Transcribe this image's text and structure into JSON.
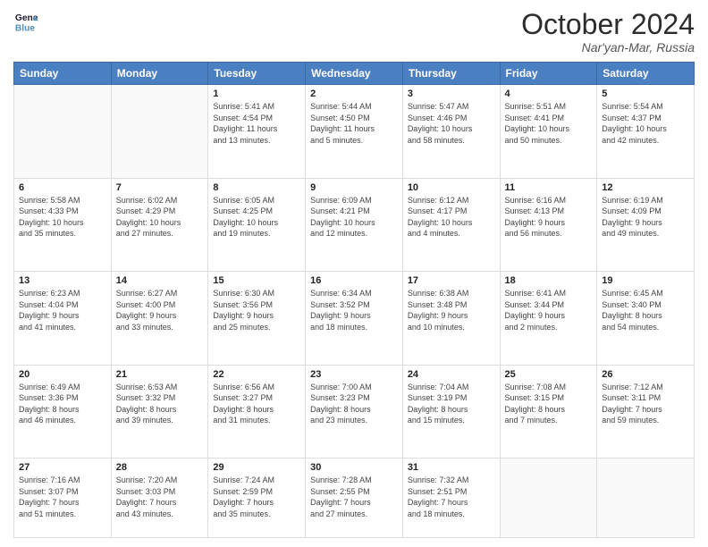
{
  "header": {
    "logo_line1": "General",
    "logo_line2": "Blue",
    "month": "October 2024",
    "location": "Nar'yan-Mar, Russia"
  },
  "weekdays": [
    "Sunday",
    "Monday",
    "Tuesday",
    "Wednesday",
    "Thursday",
    "Friday",
    "Saturday"
  ],
  "weeks": [
    [
      {
        "day": "",
        "info": ""
      },
      {
        "day": "",
        "info": ""
      },
      {
        "day": "1",
        "info": "Sunrise: 5:41 AM\nSunset: 4:54 PM\nDaylight: 11 hours\nand 13 minutes."
      },
      {
        "day": "2",
        "info": "Sunrise: 5:44 AM\nSunset: 4:50 PM\nDaylight: 11 hours\nand 5 minutes."
      },
      {
        "day": "3",
        "info": "Sunrise: 5:47 AM\nSunset: 4:46 PM\nDaylight: 10 hours\nand 58 minutes."
      },
      {
        "day": "4",
        "info": "Sunrise: 5:51 AM\nSunset: 4:41 PM\nDaylight: 10 hours\nand 50 minutes."
      },
      {
        "day": "5",
        "info": "Sunrise: 5:54 AM\nSunset: 4:37 PM\nDaylight: 10 hours\nand 42 minutes."
      }
    ],
    [
      {
        "day": "6",
        "info": "Sunrise: 5:58 AM\nSunset: 4:33 PM\nDaylight: 10 hours\nand 35 minutes."
      },
      {
        "day": "7",
        "info": "Sunrise: 6:02 AM\nSunset: 4:29 PM\nDaylight: 10 hours\nand 27 minutes."
      },
      {
        "day": "8",
        "info": "Sunrise: 6:05 AM\nSunset: 4:25 PM\nDaylight: 10 hours\nand 19 minutes."
      },
      {
        "day": "9",
        "info": "Sunrise: 6:09 AM\nSunset: 4:21 PM\nDaylight: 10 hours\nand 12 minutes."
      },
      {
        "day": "10",
        "info": "Sunrise: 6:12 AM\nSunset: 4:17 PM\nDaylight: 10 hours\nand 4 minutes."
      },
      {
        "day": "11",
        "info": "Sunrise: 6:16 AM\nSunset: 4:13 PM\nDaylight: 9 hours\nand 56 minutes."
      },
      {
        "day": "12",
        "info": "Sunrise: 6:19 AM\nSunset: 4:09 PM\nDaylight: 9 hours\nand 49 minutes."
      }
    ],
    [
      {
        "day": "13",
        "info": "Sunrise: 6:23 AM\nSunset: 4:04 PM\nDaylight: 9 hours\nand 41 minutes."
      },
      {
        "day": "14",
        "info": "Sunrise: 6:27 AM\nSunset: 4:00 PM\nDaylight: 9 hours\nand 33 minutes."
      },
      {
        "day": "15",
        "info": "Sunrise: 6:30 AM\nSunset: 3:56 PM\nDaylight: 9 hours\nand 25 minutes."
      },
      {
        "day": "16",
        "info": "Sunrise: 6:34 AM\nSunset: 3:52 PM\nDaylight: 9 hours\nand 18 minutes."
      },
      {
        "day": "17",
        "info": "Sunrise: 6:38 AM\nSunset: 3:48 PM\nDaylight: 9 hours\nand 10 minutes."
      },
      {
        "day": "18",
        "info": "Sunrise: 6:41 AM\nSunset: 3:44 PM\nDaylight: 9 hours\nand 2 minutes."
      },
      {
        "day": "19",
        "info": "Sunrise: 6:45 AM\nSunset: 3:40 PM\nDaylight: 8 hours\nand 54 minutes."
      }
    ],
    [
      {
        "day": "20",
        "info": "Sunrise: 6:49 AM\nSunset: 3:36 PM\nDaylight: 8 hours\nand 46 minutes."
      },
      {
        "day": "21",
        "info": "Sunrise: 6:53 AM\nSunset: 3:32 PM\nDaylight: 8 hours\nand 39 minutes."
      },
      {
        "day": "22",
        "info": "Sunrise: 6:56 AM\nSunset: 3:27 PM\nDaylight: 8 hours\nand 31 minutes."
      },
      {
        "day": "23",
        "info": "Sunrise: 7:00 AM\nSunset: 3:23 PM\nDaylight: 8 hours\nand 23 minutes."
      },
      {
        "day": "24",
        "info": "Sunrise: 7:04 AM\nSunset: 3:19 PM\nDaylight: 8 hours\nand 15 minutes."
      },
      {
        "day": "25",
        "info": "Sunrise: 7:08 AM\nSunset: 3:15 PM\nDaylight: 8 hours\nand 7 minutes."
      },
      {
        "day": "26",
        "info": "Sunrise: 7:12 AM\nSunset: 3:11 PM\nDaylight: 7 hours\nand 59 minutes."
      }
    ],
    [
      {
        "day": "27",
        "info": "Sunrise: 7:16 AM\nSunset: 3:07 PM\nDaylight: 7 hours\nand 51 minutes."
      },
      {
        "day": "28",
        "info": "Sunrise: 7:20 AM\nSunset: 3:03 PM\nDaylight: 7 hours\nand 43 minutes."
      },
      {
        "day": "29",
        "info": "Sunrise: 7:24 AM\nSunset: 2:59 PM\nDaylight: 7 hours\nand 35 minutes."
      },
      {
        "day": "30",
        "info": "Sunrise: 7:28 AM\nSunset: 2:55 PM\nDaylight: 7 hours\nand 27 minutes."
      },
      {
        "day": "31",
        "info": "Sunrise: 7:32 AM\nSunset: 2:51 PM\nDaylight: 7 hours\nand 18 minutes."
      },
      {
        "day": "",
        "info": ""
      },
      {
        "day": "",
        "info": ""
      }
    ]
  ]
}
